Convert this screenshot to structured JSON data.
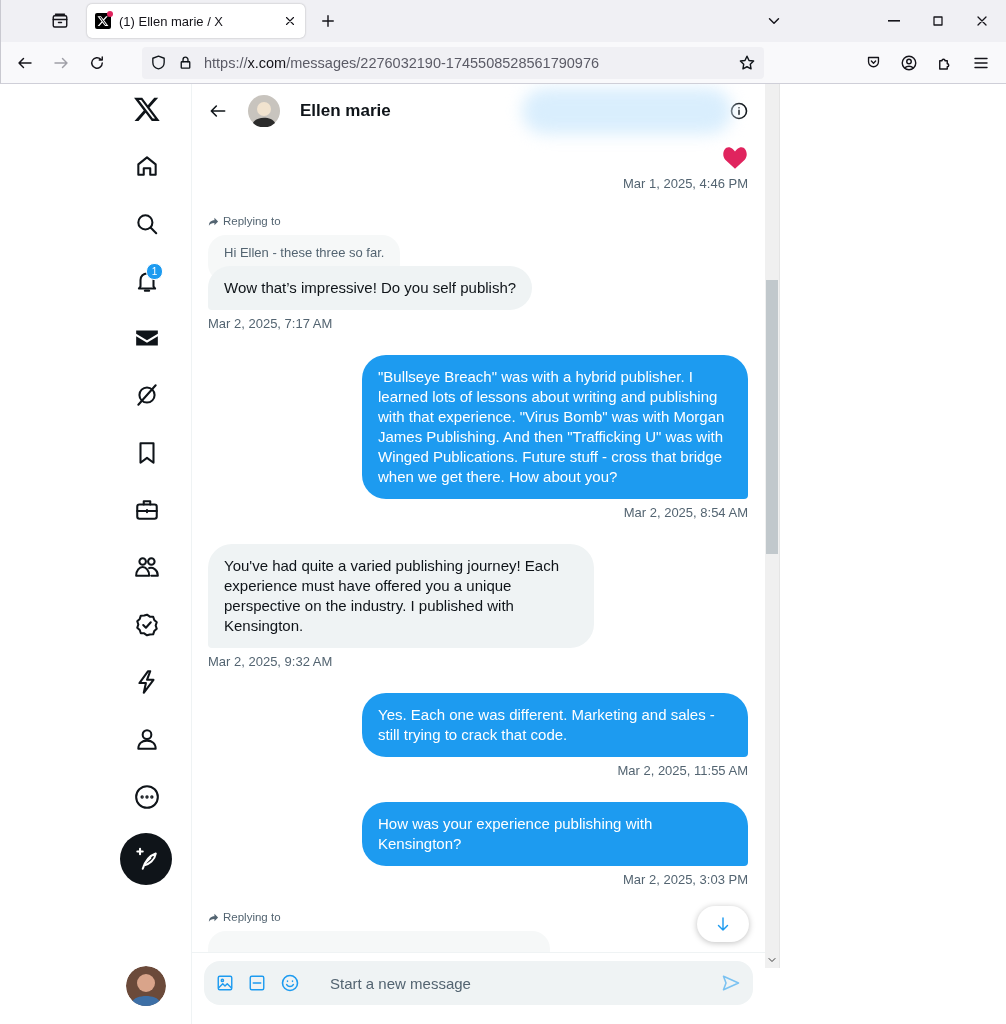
{
  "browser": {
    "tab": {
      "title": "(1) Ellen marie / X",
      "selected": true
    },
    "url": {
      "scheme": "https://",
      "host": "x.com",
      "path": "/messages/2276032190-1745508528561790976"
    }
  },
  "nav_items": [
    {
      "kind": "home",
      "selected": false
    },
    {
      "kind": "search",
      "selected": false
    },
    {
      "kind": "bell",
      "selected": false,
      "badge": "1"
    },
    {
      "kind": "mail",
      "selected": true
    },
    {
      "kind": "grok",
      "selected": false
    },
    {
      "kind": "bookmark",
      "selected": false
    },
    {
      "kind": "jobs",
      "selected": false
    },
    {
      "kind": "communities",
      "selected": false
    },
    {
      "kind": "verified",
      "selected": false
    },
    {
      "kind": "bolt",
      "selected": false
    },
    {
      "kind": "profile",
      "selected": false
    },
    {
      "kind": "more",
      "selected": false
    }
  ],
  "conversation": {
    "name": "Ellen marie"
  },
  "messages": [
    {
      "kind": "reaction",
      "time": "Mar 1, 2025, 4:46 PM"
    },
    {
      "kind": "received",
      "replying_label": "Replying to",
      "quote": "Hi Ellen - these three so far.",
      "text": "Wow that’s impressive! Do you self publish?",
      "time": "Mar 2, 2025, 7:17 AM"
    },
    {
      "kind": "sent",
      "text": "\"Bullseye Breach\" was with a hybrid publisher. I learned lots of lessons about writing and publishing with that experience. \"Virus Bomb\" was with Morgan James Publishing. And then \"Trafficking U\" was with Winged Publications. Future stuff - cross that bridge when we get there. How about you?",
      "time": "Mar 2, 2025, 8:54 AM"
    },
    {
      "kind": "received",
      "text": "You've had quite a varied publishing journey! Each experience must have offered you a unique perspective on the industry. I published with Kensington.",
      "time": "Mar 2, 2025, 9:32 AM"
    },
    {
      "kind": "sent",
      "text": "Yes. Each one was different. Marketing and sales - still trying to crack that code.",
      "time": "Mar 2, 2025, 11:55 AM"
    },
    {
      "kind": "sent",
      "text": "How was your experience publishing with Kensington?",
      "time": "Mar 2, 2025, 3:03 PM"
    },
    {
      "kind": "partial",
      "replying_label": "Replying to"
    }
  ],
  "composer": {
    "placeholder": "Start a new message"
  }
}
